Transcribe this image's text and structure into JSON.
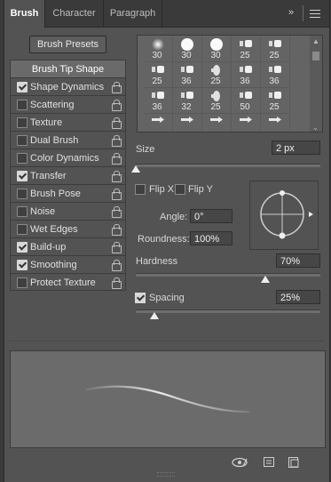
{
  "tabs": [
    {
      "label": "Brush"
    },
    {
      "label": "Character"
    },
    {
      "label": "Paragraph"
    }
  ],
  "toolbar": {
    "collapse_glyph": "»",
    "menu_icon": "hamburger-menu-icon"
  },
  "presets_button": "Brush Presets",
  "options_header": "Brush Tip Shape",
  "options": [
    {
      "label": "Shape Dynamics",
      "checked": true
    },
    {
      "label": "Scattering",
      "checked": false
    },
    {
      "label": "Texture",
      "checked": false
    },
    {
      "label": "Dual Brush",
      "checked": false
    },
    {
      "label": "Color Dynamics",
      "checked": false
    },
    {
      "label": "Transfer",
      "checked": true
    },
    {
      "label": "Brush Pose",
      "checked": false
    },
    {
      "label": "Noise",
      "checked": false
    },
    {
      "label": "Wet Edges",
      "checked": false
    },
    {
      "label": "Build-up",
      "checked": true
    },
    {
      "label": "Smoothing",
      "checked": true
    },
    {
      "label": "Protect Texture",
      "checked": false
    }
  ],
  "brush_tips": [
    {
      "size": "30"
    },
    {
      "size": "30"
    },
    {
      "size": "30"
    },
    {
      "size": "25"
    },
    {
      "size": "25"
    },
    {
      "size": "25"
    },
    {
      "size": "36"
    },
    {
      "size": "25"
    },
    {
      "size": "36"
    },
    {
      "size": "36"
    },
    {
      "size": "36"
    },
    {
      "size": "32"
    },
    {
      "size": "25"
    },
    {
      "size": "50"
    },
    {
      "size": "25"
    },
    {
      "size": ""
    },
    {
      "size": ""
    },
    {
      "size": ""
    },
    {
      "size": ""
    },
    {
      "size": ""
    }
  ],
  "size": {
    "label": "Size",
    "value": "2 px",
    "fraction": 0.0
  },
  "flip_x": {
    "label": "Flip X",
    "checked": false
  },
  "flip_y": {
    "label": "Flip Y",
    "checked": false
  },
  "angle": {
    "label": "Angle:",
    "value": "0°"
  },
  "roundness": {
    "label": "Roundness:",
    "value": "100%"
  },
  "hardness": {
    "label": "Hardness",
    "value": "70%",
    "fraction": 0.7
  },
  "spacing": {
    "label": "Spacing",
    "value": "25%",
    "checked": true,
    "fraction": 0.1
  },
  "bottom_icons": [
    "visibility-toggle-icon",
    "grid-panel-icon",
    "new-preset-icon"
  ]
}
